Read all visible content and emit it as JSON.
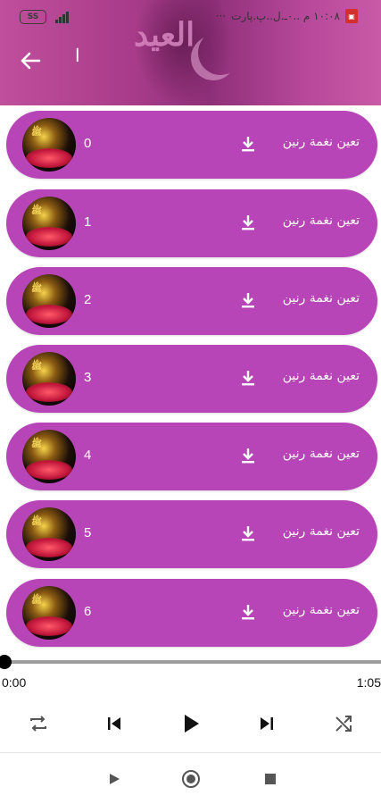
{
  "status_bar": {
    "left_icon_text": "SS",
    "right_text": "١٠:٠٨ م ..٠ـ.ل..پ.پارت",
    "dots": "···"
  },
  "header": {
    "title": "ا",
    "decoration_text": "العيد"
  },
  "items": [
    {
      "index": "0",
      "label": "تعين نغمة رنين"
    },
    {
      "index": "1",
      "label": "تعين نغمة رنين"
    },
    {
      "index": "2",
      "label": "تعين نغمة رنين"
    },
    {
      "index": "3",
      "label": "تعين نغمة رنين"
    },
    {
      "index": "4",
      "label": "تعين نغمة رنين"
    },
    {
      "index": "5",
      "label": "تعين نغمة رنين"
    },
    {
      "index": "6",
      "label": "تعين نغمة رنين"
    }
  ],
  "player": {
    "current_time": "0:00",
    "total_time": "1:05",
    "progress": 0.0
  },
  "icons": {
    "back": "arrow-left-icon",
    "download": "download-icon",
    "repeat": "repeat-icon",
    "previous": "skip-previous-icon",
    "play": "play-icon",
    "next": "skip-next-icon",
    "shuffle": "shuffle-icon"
  },
  "colors": {
    "row_bg": "#b845b8",
    "header_bg": "#a83c8a",
    "text": "#ffffff"
  }
}
